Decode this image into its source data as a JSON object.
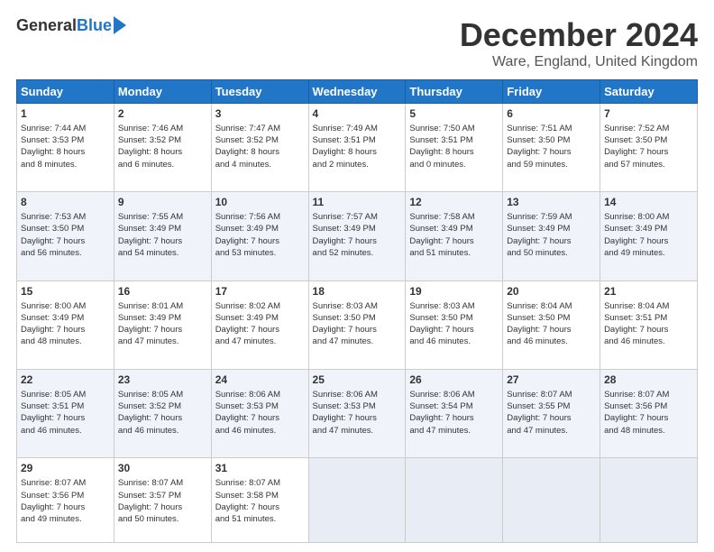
{
  "header": {
    "logo_general": "General",
    "logo_blue": "Blue",
    "title": "December 2024",
    "location": "Ware, England, United Kingdom"
  },
  "weekdays": [
    "Sunday",
    "Monday",
    "Tuesday",
    "Wednesday",
    "Thursday",
    "Friday",
    "Saturday"
  ],
  "weeks": [
    [
      {
        "day": 1,
        "lines": [
          "Sunrise: 7:44 AM",
          "Sunset: 3:53 PM",
          "Daylight: 8 hours",
          "and 8 minutes."
        ]
      },
      {
        "day": 2,
        "lines": [
          "Sunrise: 7:46 AM",
          "Sunset: 3:52 PM",
          "Daylight: 8 hours",
          "and 6 minutes."
        ]
      },
      {
        "day": 3,
        "lines": [
          "Sunrise: 7:47 AM",
          "Sunset: 3:52 PM",
          "Daylight: 8 hours",
          "and 4 minutes."
        ]
      },
      {
        "day": 4,
        "lines": [
          "Sunrise: 7:49 AM",
          "Sunset: 3:51 PM",
          "Daylight: 8 hours",
          "and 2 minutes."
        ]
      },
      {
        "day": 5,
        "lines": [
          "Sunrise: 7:50 AM",
          "Sunset: 3:51 PM",
          "Daylight: 8 hours",
          "and 0 minutes."
        ]
      },
      {
        "day": 6,
        "lines": [
          "Sunrise: 7:51 AM",
          "Sunset: 3:50 PM",
          "Daylight: 7 hours",
          "and 59 minutes."
        ]
      },
      {
        "day": 7,
        "lines": [
          "Sunrise: 7:52 AM",
          "Sunset: 3:50 PM",
          "Daylight: 7 hours",
          "and 57 minutes."
        ]
      }
    ],
    [
      {
        "day": 8,
        "lines": [
          "Sunrise: 7:53 AM",
          "Sunset: 3:50 PM",
          "Daylight: 7 hours",
          "and 56 minutes."
        ]
      },
      {
        "day": 9,
        "lines": [
          "Sunrise: 7:55 AM",
          "Sunset: 3:49 PM",
          "Daylight: 7 hours",
          "and 54 minutes."
        ]
      },
      {
        "day": 10,
        "lines": [
          "Sunrise: 7:56 AM",
          "Sunset: 3:49 PM",
          "Daylight: 7 hours",
          "and 53 minutes."
        ]
      },
      {
        "day": 11,
        "lines": [
          "Sunrise: 7:57 AM",
          "Sunset: 3:49 PM",
          "Daylight: 7 hours",
          "and 52 minutes."
        ]
      },
      {
        "day": 12,
        "lines": [
          "Sunrise: 7:58 AM",
          "Sunset: 3:49 PM",
          "Daylight: 7 hours",
          "and 51 minutes."
        ]
      },
      {
        "day": 13,
        "lines": [
          "Sunrise: 7:59 AM",
          "Sunset: 3:49 PM",
          "Daylight: 7 hours",
          "and 50 minutes."
        ]
      },
      {
        "day": 14,
        "lines": [
          "Sunrise: 8:00 AM",
          "Sunset: 3:49 PM",
          "Daylight: 7 hours",
          "and 49 minutes."
        ]
      }
    ],
    [
      {
        "day": 15,
        "lines": [
          "Sunrise: 8:00 AM",
          "Sunset: 3:49 PM",
          "Daylight: 7 hours",
          "and 48 minutes."
        ]
      },
      {
        "day": 16,
        "lines": [
          "Sunrise: 8:01 AM",
          "Sunset: 3:49 PM",
          "Daylight: 7 hours",
          "and 47 minutes."
        ]
      },
      {
        "day": 17,
        "lines": [
          "Sunrise: 8:02 AM",
          "Sunset: 3:49 PM",
          "Daylight: 7 hours",
          "and 47 minutes."
        ]
      },
      {
        "day": 18,
        "lines": [
          "Sunrise: 8:03 AM",
          "Sunset: 3:50 PM",
          "Daylight: 7 hours",
          "and 47 minutes."
        ]
      },
      {
        "day": 19,
        "lines": [
          "Sunrise: 8:03 AM",
          "Sunset: 3:50 PM",
          "Daylight: 7 hours",
          "and 46 minutes."
        ]
      },
      {
        "day": 20,
        "lines": [
          "Sunrise: 8:04 AM",
          "Sunset: 3:50 PM",
          "Daylight: 7 hours",
          "and 46 minutes."
        ]
      },
      {
        "day": 21,
        "lines": [
          "Sunrise: 8:04 AM",
          "Sunset: 3:51 PM",
          "Daylight: 7 hours",
          "and 46 minutes."
        ]
      }
    ],
    [
      {
        "day": 22,
        "lines": [
          "Sunrise: 8:05 AM",
          "Sunset: 3:51 PM",
          "Daylight: 7 hours",
          "and 46 minutes."
        ]
      },
      {
        "day": 23,
        "lines": [
          "Sunrise: 8:05 AM",
          "Sunset: 3:52 PM",
          "Daylight: 7 hours",
          "and 46 minutes."
        ]
      },
      {
        "day": 24,
        "lines": [
          "Sunrise: 8:06 AM",
          "Sunset: 3:53 PM",
          "Daylight: 7 hours",
          "and 46 minutes."
        ]
      },
      {
        "day": 25,
        "lines": [
          "Sunrise: 8:06 AM",
          "Sunset: 3:53 PM",
          "Daylight: 7 hours",
          "and 47 minutes."
        ]
      },
      {
        "day": 26,
        "lines": [
          "Sunrise: 8:06 AM",
          "Sunset: 3:54 PM",
          "Daylight: 7 hours",
          "and 47 minutes."
        ]
      },
      {
        "day": 27,
        "lines": [
          "Sunrise: 8:07 AM",
          "Sunset: 3:55 PM",
          "Daylight: 7 hours",
          "and 47 minutes."
        ]
      },
      {
        "day": 28,
        "lines": [
          "Sunrise: 8:07 AM",
          "Sunset: 3:56 PM",
          "Daylight: 7 hours",
          "and 48 minutes."
        ]
      }
    ],
    [
      {
        "day": 29,
        "lines": [
          "Sunrise: 8:07 AM",
          "Sunset: 3:56 PM",
          "Daylight: 7 hours",
          "and 49 minutes."
        ]
      },
      {
        "day": 30,
        "lines": [
          "Sunrise: 8:07 AM",
          "Sunset: 3:57 PM",
          "Daylight: 7 hours",
          "and 50 minutes."
        ]
      },
      {
        "day": 31,
        "lines": [
          "Sunrise: 8:07 AM",
          "Sunset: 3:58 PM",
          "Daylight: 7 hours",
          "and 51 minutes."
        ]
      },
      null,
      null,
      null,
      null
    ]
  ]
}
